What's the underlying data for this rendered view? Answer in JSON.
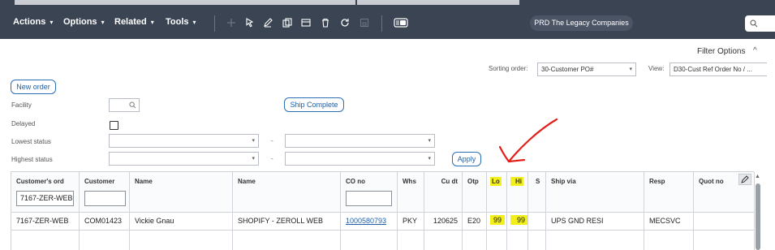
{
  "toolbar": {
    "menus": [
      {
        "label": "Actions"
      },
      {
        "label": "Options"
      },
      {
        "label": "Related"
      },
      {
        "label": "Tools"
      }
    ],
    "icons": [
      "plus-icon",
      "select-cursor-icon",
      "edit-pencil-icon",
      "copy-icon",
      "window-icon",
      "delete-icon",
      "refresh-icon",
      "save-icon",
      "toggle-panel-icon"
    ],
    "environment": "PRD The Legacy Companies",
    "search_icon": "search-icon"
  },
  "filter_panel": {
    "filter_options_label": "Filter Options",
    "sorting_order_label": "Sorting order:",
    "sorting_order_value": "30-Customer PO#",
    "view_label": "View:",
    "view_value": "D30-Cust Ref Order No / ...",
    "new_order_label": "New order",
    "facility_label": "Facility",
    "delayed_label": "Delayed",
    "lowest_status_label": "Lowest status",
    "highest_status_label": "Highest status",
    "ship_complete_label": "Ship Complete",
    "apply_label": "Apply",
    "range_separator": "-"
  },
  "grid": {
    "columns": [
      {
        "key": "cust_ord",
        "label": "Customer's ord"
      },
      {
        "key": "customer",
        "label": "Customer"
      },
      {
        "key": "name1",
        "label": "Name"
      },
      {
        "key": "name2",
        "label": "Name"
      },
      {
        "key": "co_no",
        "label": "CO no"
      },
      {
        "key": "whs",
        "label": "Whs"
      },
      {
        "key": "cu_dt",
        "label": "Cu dt"
      },
      {
        "key": "otp",
        "label": "Otp"
      },
      {
        "key": "lo",
        "label": "Lo"
      },
      {
        "key": "hi",
        "label": "Hi"
      },
      {
        "key": "s",
        "label": "S"
      },
      {
        "key": "ship_via",
        "label": "Ship via"
      },
      {
        "key": "resp",
        "label": "Resp"
      },
      {
        "key": "quot_no",
        "label": "Quot no"
      }
    ],
    "filter_values": {
      "cust_ord": "7167-ZER-WEB",
      "customer": "",
      "co_no": ""
    },
    "rows": [
      {
        "cust_ord": "7167-ZER-WEB",
        "customer": "COM01423",
        "name1": "Vickie Gnau",
        "name2": "SHOPIFY - ZEROLL WEB",
        "co_no": "1000580793",
        "whs": "PKY",
        "cu_dt": "120625",
        "otp": "E20",
        "lo": "99",
        "hi": "99",
        "s": "",
        "ship_via": "UPS GND RESI",
        "resp": "MECSVC",
        "quot_no": ""
      }
    ],
    "highlight_color": "#f2ef1a"
  },
  "annotation": {
    "color": "#e0201b",
    "shape": "hand-drawn-check-arrow"
  }
}
